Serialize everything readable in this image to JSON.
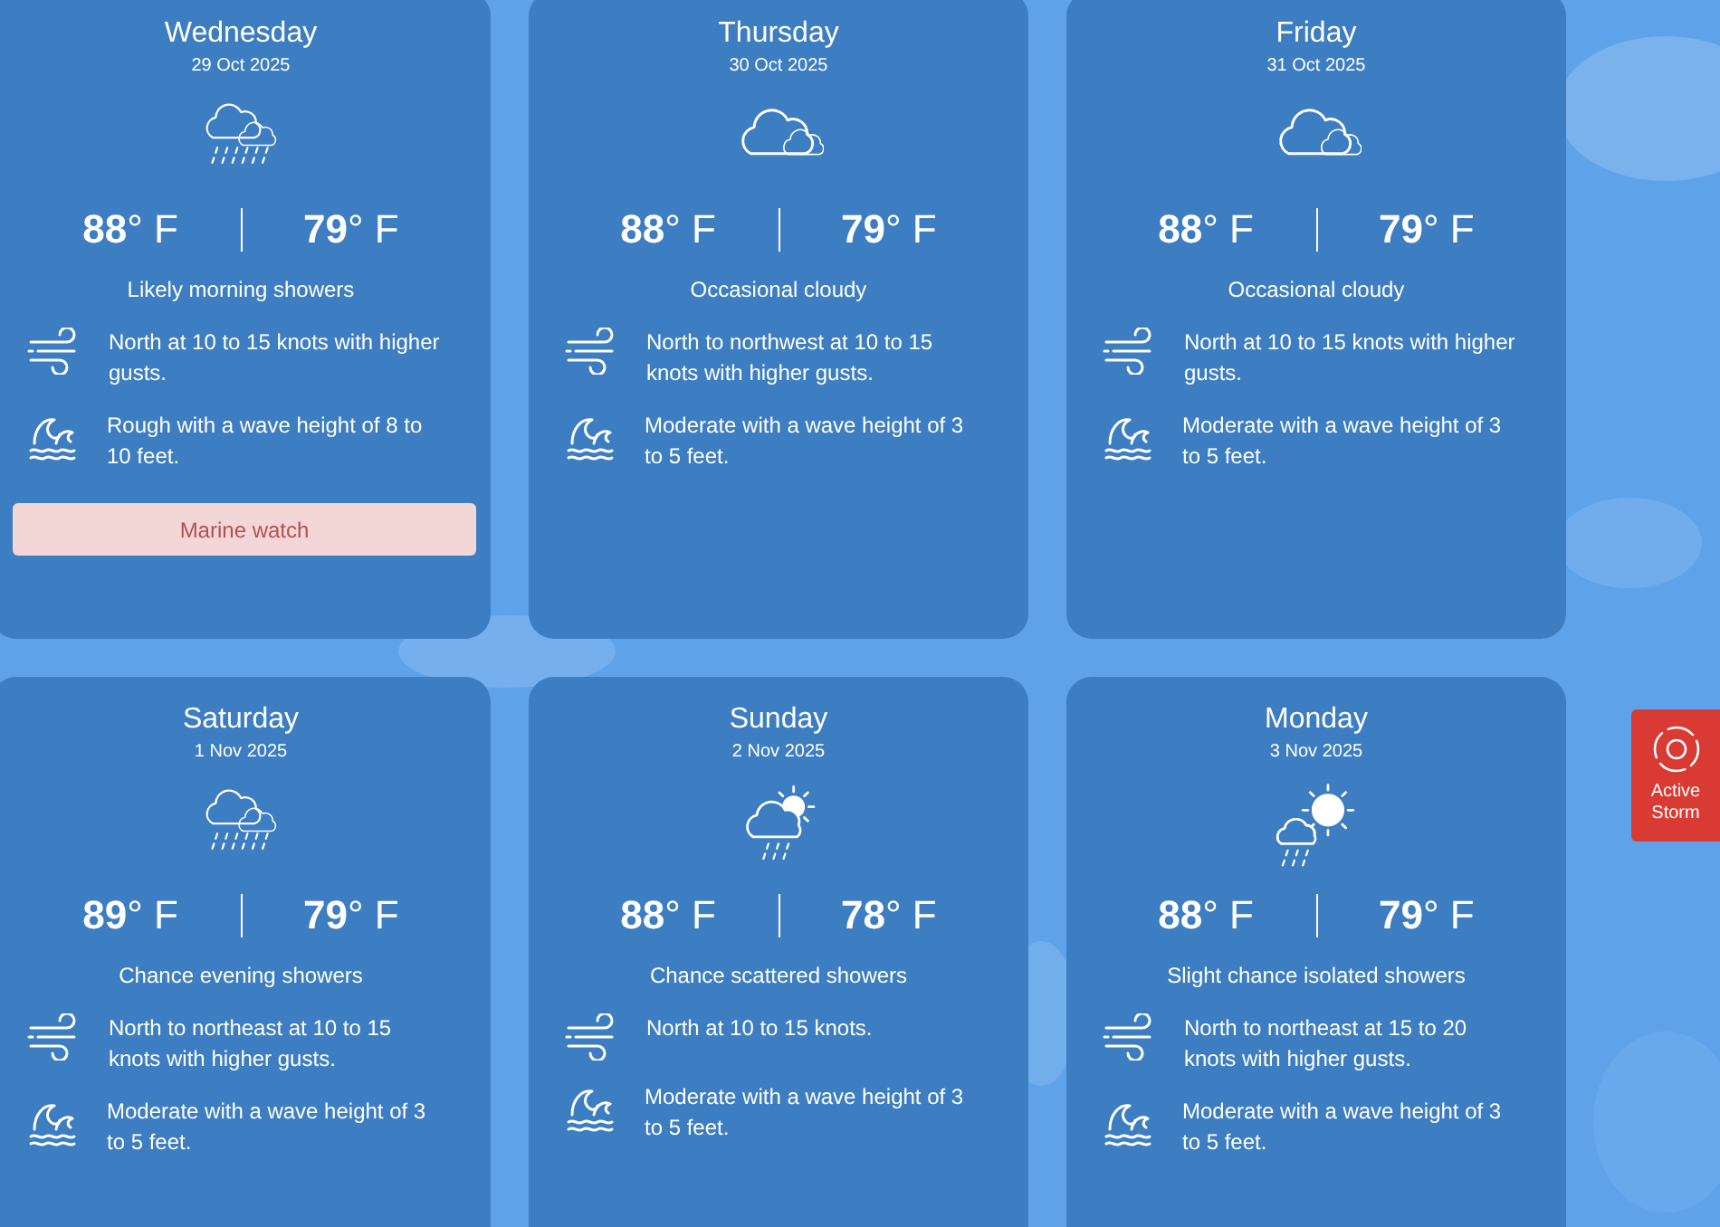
{
  "days": [
    {
      "day": "Wednesday",
      "date": "29 Oct 2025",
      "kind": "rain",
      "high": {
        "value": "88",
        "unit": "° F"
      },
      "low": {
        "value": "79",
        "unit": "° F"
      },
      "condition": "Likely morning showers",
      "wind": "North at 10 to 15 knots with higher gusts.",
      "waves": "Rough with a wave height of 8 to 10 feet.",
      "alert": "Marine watch"
    },
    {
      "day": "Thursday",
      "date": "30 Oct 2025",
      "kind": "cloudy",
      "high": {
        "value": "88",
        "unit": "° F"
      },
      "low": {
        "value": "79",
        "unit": "° F"
      },
      "condition": "Occasional cloudy",
      "wind": "North to northwest at 10 to 15 knots with higher gusts.",
      "waves": "Moderate with a wave height of 3 to 5 feet."
    },
    {
      "day": "Friday",
      "date": "31 Oct 2025",
      "kind": "cloudy",
      "high": {
        "value": "88",
        "unit": "° F"
      },
      "low": {
        "value": "79",
        "unit": "° F"
      },
      "condition": "Occasional cloudy",
      "wind": "North at 10 to 15 knots with higher gusts.",
      "waves": "Moderate with a wave height of 3 to 5 feet."
    },
    {
      "day": "Saturday",
      "date": "1 Nov 2025",
      "kind": "rain",
      "high": {
        "value": "89",
        "unit": "° F"
      },
      "low": {
        "value": "79",
        "unit": "° F"
      },
      "condition": "Chance evening showers",
      "wind": "North to northeast at 10 to 15 knots with higher gusts.",
      "waves": "Moderate with a wave height of 3 to 5 feet."
    },
    {
      "day": "Sunday",
      "date": "2 Nov 2025",
      "kind": "sun-rain",
      "high": {
        "value": "88",
        "unit": "° F"
      },
      "low": {
        "value": "78",
        "unit": "° F"
      },
      "condition": "Chance scattered showers",
      "wind": "North at 10 to 15 knots.",
      "waves": "Moderate with a wave height of 3 to 5 feet."
    },
    {
      "day": "Monday",
      "date": "3 Nov 2025",
      "kind": "sunny-cloud",
      "high": {
        "value": "88",
        "unit": "° F"
      },
      "low": {
        "value": "79",
        "unit": "° F"
      },
      "condition": "Slight chance isolated showers",
      "wind": "North to northeast at 15 to 20 knots with higher gusts.",
      "waves": "Moderate with a wave height of 3 to 5 feet."
    }
  ],
  "storm_badge": {
    "line_1": "Active",
    "line_2": "Storm"
  }
}
